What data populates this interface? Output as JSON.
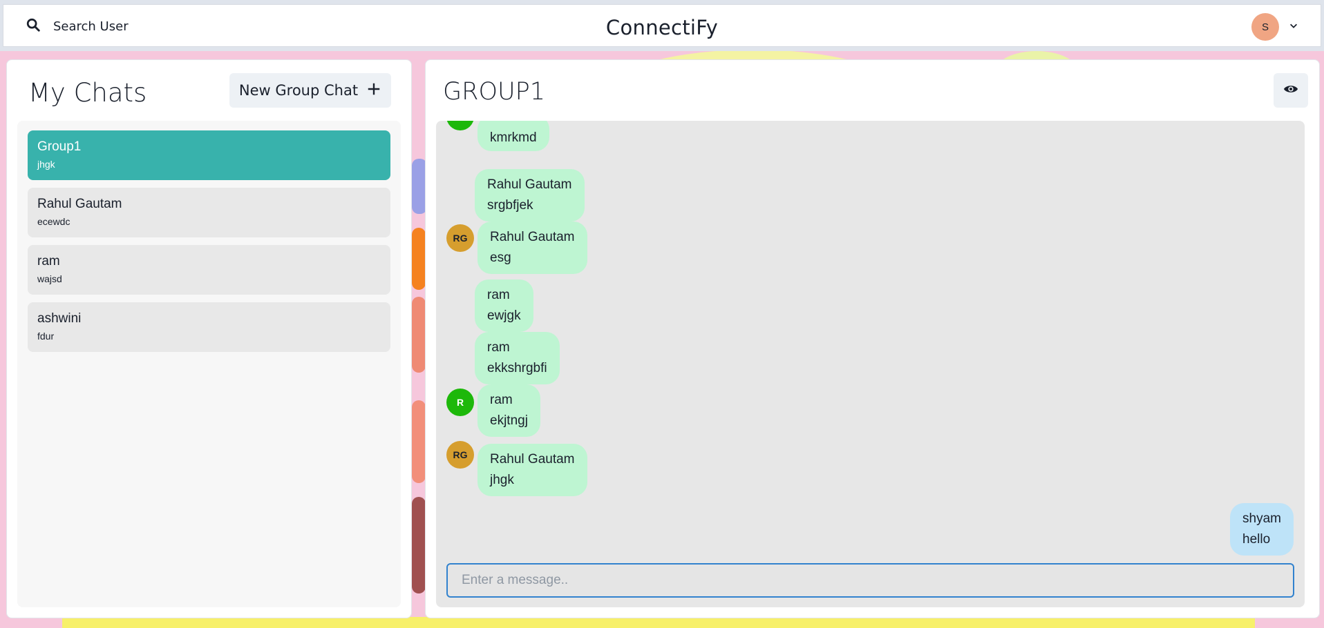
{
  "app": {
    "title": "ConnectiFy",
    "search_label": "Search User",
    "user_initial": "S"
  },
  "chats": {
    "title": "My Chats",
    "new_group_label": "New Group Chat",
    "items": [
      {
        "name": "Group1",
        "preview": "jhgk",
        "active": true
      },
      {
        "name": "Rahul Gautam",
        "preview": "ecewdc",
        "active": false
      },
      {
        "name": "ram",
        "preview": "wajsd",
        "active": false
      },
      {
        "name": "ashwini",
        "preview": "fdur",
        "active": false
      }
    ]
  },
  "conversation": {
    "title": "GROUP1",
    "input_placeholder": "Enter a message..",
    "messages": [
      {
        "sender": "",
        "text": "kmrkmd",
        "mine": false
      },
      {
        "sender": "Rahul Gautam",
        "text": "srgbfjek",
        "mine": false
      },
      {
        "sender": "Rahul Gautam",
        "text": "esg",
        "mine": false,
        "avatar": "RG"
      },
      {
        "sender": "ram",
        "text": "ewjgk",
        "mine": false
      },
      {
        "sender": "ram",
        "text": "ekkshrgbfi",
        "mine": false
      },
      {
        "sender": "ram",
        "text": "ekjtngj",
        "mine": false,
        "avatar": "R"
      },
      {
        "sender": "Rahul Gautam",
        "text": "jhgk",
        "mine": false,
        "avatar": "RG"
      },
      {
        "sender": "shyam",
        "text": "hello",
        "mine": true
      }
    ]
  },
  "colors": {
    "accent": "#38b2ac",
    "received_bubble": "#bef5d2",
    "sent_bubble": "#bee3f8",
    "avatar_rg": "#d69e2e",
    "avatar_r": "#1db80a",
    "user_avatar": "#f0a583"
  },
  "icons": {
    "search": "search-icon",
    "dropdown": "chevron-down-icon",
    "add": "plus-icon",
    "view": "eye-icon"
  }
}
